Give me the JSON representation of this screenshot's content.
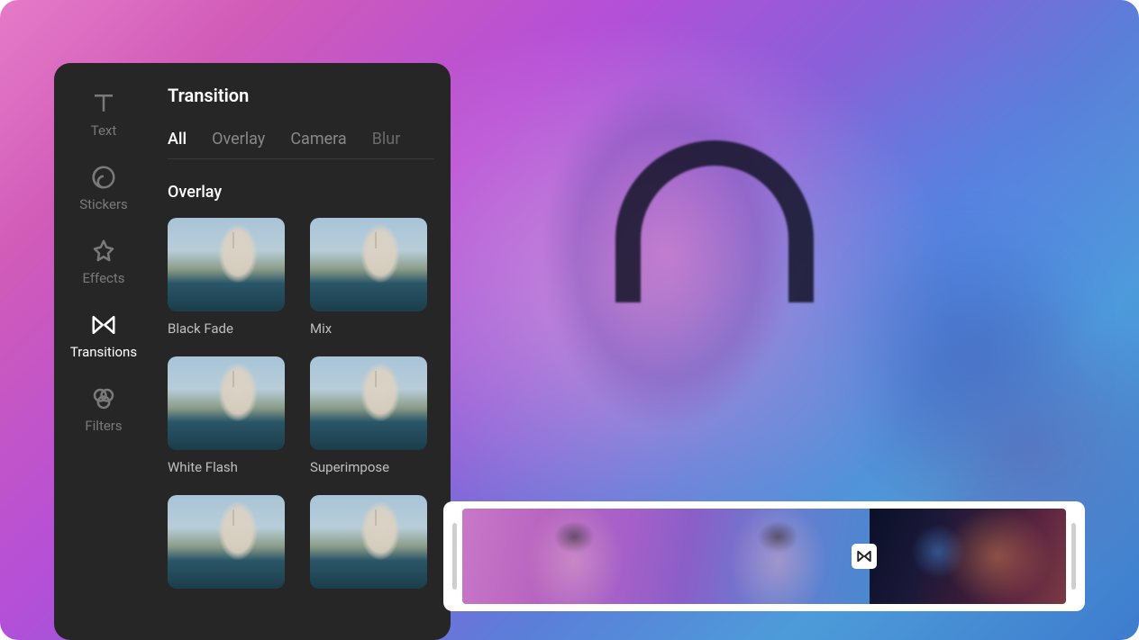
{
  "panel": {
    "title": "Transition",
    "tabs": [
      "All",
      "Overlay",
      "Camera",
      "Blur"
    ],
    "activeTab": 0,
    "sectionTitle": "Overlay",
    "items": [
      {
        "label": "Black Fade"
      },
      {
        "label": "Mix"
      },
      {
        "label": "White Flash"
      },
      {
        "label": "Superimpose"
      },
      {
        "label": ""
      },
      {
        "label": ""
      }
    ]
  },
  "sidebar": {
    "items": [
      {
        "id": "text",
        "label": "Text",
        "icon": "text-icon"
      },
      {
        "id": "stickers",
        "label": "Stickers",
        "icon": "sticker-icon"
      },
      {
        "id": "effects",
        "label": "Effects",
        "icon": "star-icon"
      },
      {
        "id": "transitions",
        "label": "Transitions",
        "icon": "transition-icon",
        "active": true
      },
      {
        "id": "filters",
        "label": "Filters",
        "icon": "filter-icon"
      }
    ]
  },
  "timeline": {
    "marker": "transition"
  }
}
